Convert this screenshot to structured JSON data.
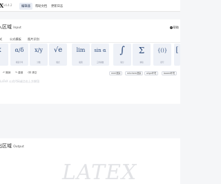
{
  "topbar": {
    "brand": "X",
    "version": "v4.4.2",
    "nav": [
      "编辑器",
      "帮助文档",
      "更新日志"
    ]
  },
  "input": {
    "title": "入区域",
    "subtitle": "Input",
    "help": "帮助",
    "tabs": [
      "式",
      "公式模板",
      "图片识别"
    ],
    "tiles": [
      {
        "sym": "x",
        "cap": ""
      },
      {
        "sym": "α/δ",
        "cap": "希腊字母"
      },
      {
        "sym": "x/y",
        "cap": "分数"
      },
      {
        "sym": "√e",
        "cap": "根式"
      },
      {
        "sym": "lim",
        "cap": "极限"
      },
      {
        "sym": "sin α",
        "cap": "三角函数"
      },
      {
        "sym": "∫",
        "cap": "积分"
      },
      {
        "sym": "Σ",
        "cap": "求和"
      },
      {
        "sym": "{()}",
        "cap": "括号"
      },
      {
        "sym": "[",
        "cap": ""
      }
    ],
    "toolbar": {
      "left": [
        "撤销",
        "重做",
        "清空"
      ],
      "pills": [
        "mml渲染",
        "mhchem渲染",
        "align环境",
        "boxed环境"
      ]
    },
    "placeholder": "LaTeX 公式代码或点击上方按钮"
  },
  "output": {
    "title": "出区域",
    "subtitle": "Output",
    "watermark": "LATEX"
  }
}
